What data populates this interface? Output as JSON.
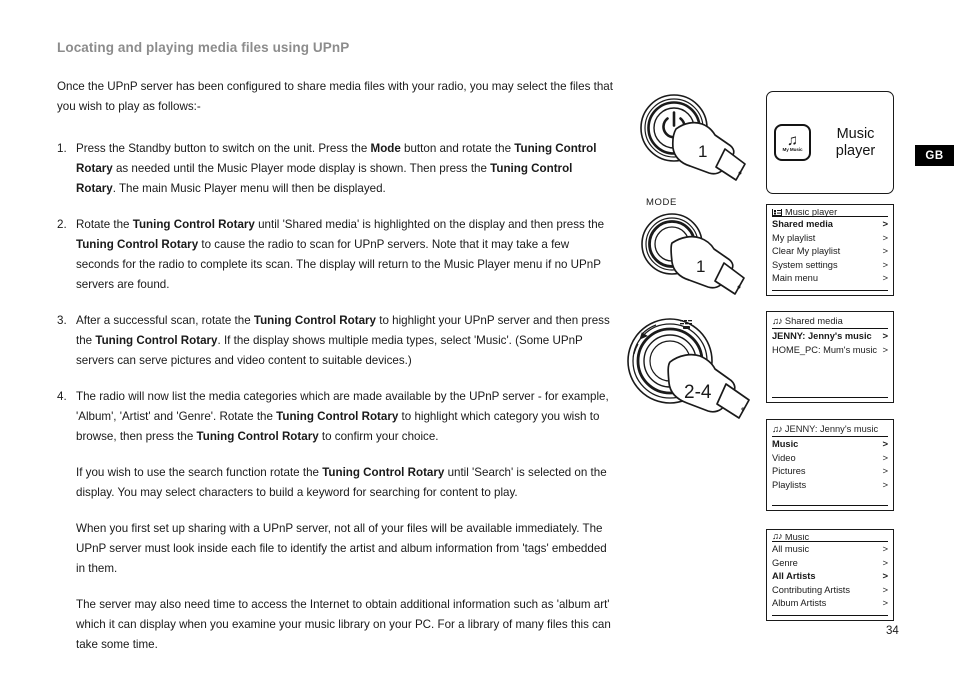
{
  "page": {
    "heading": "Locating and playing media files using UPnP",
    "number": "34",
    "region_badge": "GB"
  },
  "body": {
    "intro": "Once the UPnP server has been configured to share media files with your radio, you may select the files that you wish to play as follows:-",
    "steps": [
      {
        "num": "1.",
        "parts": [
          {
            "t": "Press the Standby button to switch on the unit. Press the ",
            "b": false
          },
          {
            "t": "Mode",
            "b": true
          },
          {
            "t": " button and rotate the ",
            "b": false
          },
          {
            "t": "Tuning Control Rotary",
            "b": true
          },
          {
            "t": " as needed until the Music Player mode display is shown. Then press the ",
            "b": false
          },
          {
            "t": "Tuning Control Rotary",
            "b": true
          },
          {
            "t": ". The main Music Player menu will then be displayed.",
            "b": false
          }
        ]
      },
      {
        "num": "2.",
        "parts": [
          {
            "t": "Rotate the ",
            "b": false
          },
          {
            "t": "Tuning Control Rotary",
            "b": true
          },
          {
            "t": " until 'Shared media' is highlighted on the display and then press the ",
            "b": false
          },
          {
            "t": "Tuning Control Rotary",
            "b": true
          },
          {
            "t": " to cause the radio to scan for UPnP servers. Note that it may take a few seconds for the radio to complete its scan. The display will return to the Music Player menu if no UPnP servers are found.",
            "b": false
          }
        ]
      },
      {
        "num": "3.",
        "parts": [
          {
            "t": "After a successful scan, rotate the ",
            "b": false
          },
          {
            "t": "Tuning Control Rotary",
            "b": true
          },
          {
            "t": " to highlight your UPnP server and then press the ",
            "b": false
          },
          {
            "t": "Tuning Control Rotary",
            "b": true
          },
          {
            "t": ". If the display shows multiple media types, select 'Music'. (Some UPnP servers can serve pictures and video content to suitable devices.)",
            "b": false
          }
        ]
      },
      {
        "num": "4.",
        "parts": [
          {
            "t": "The radio will now list the media categories which are made available by the UPnP server - for example, 'Album', 'Artist' and 'Genre'. Rotate the ",
            "b": false
          },
          {
            "t": "Tuning Control Rotary",
            "b": true
          },
          {
            "t": " to highlight which category you wish to browse, then press the ",
            "b": false
          },
          {
            "t": "Tuning Control Rotary",
            "b": true
          },
          {
            "t": " to confirm your choice.",
            "b": false
          }
        ],
        "sub_parts": [
          {
            "t": "If you wish to use the search function rotate the ",
            "b": false
          },
          {
            "t": "Tuning Control Rotary",
            "b": true
          },
          {
            "t": " until 'Search' is selected on the display. You may select characters to build a keyword for searching for content to play.",
            "b": false
          }
        ]
      }
    ],
    "notes": [
      "When you first set up sharing with a UPnP server, not all of your files will be available immediately. The UPnP server must look inside each file to identify the artist and album information from 'tags' embedded in them.",
      "The server may also need time to access the Internet to obtain additional information such as 'album art' which it can display when you examine your music library on your PC. For a library of many files this can take some time."
    ]
  },
  "illustrations": [
    {
      "name": "standby-button-press",
      "step_label": "1",
      "caption": ""
    },
    {
      "name": "mode-button-press",
      "step_label": "1",
      "caption": "MODE"
    },
    {
      "name": "tuning-control-rotary",
      "step_label": "2-4",
      "caption": ""
    }
  ],
  "displays": {
    "splash": {
      "icon_label": "My Music",
      "icon_glyph": "♫",
      "title_line1": "Music",
      "title_line2": "player"
    },
    "menus": [
      {
        "header": "Music player",
        "header_icon": "list-icon",
        "rows": [
          {
            "label": "Shared media",
            "chev": ">",
            "selected": true
          },
          {
            "label": "My playlist",
            "chev": ">",
            "selected": false
          },
          {
            "label": "Clear My playlist",
            "chev": ">",
            "selected": false
          },
          {
            "label": "System settings",
            "chev": ">",
            "selected": false
          },
          {
            "label": "Main menu",
            "chev": ">",
            "selected": false
          }
        ]
      },
      {
        "header": "Shared media",
        "header_icon": "note-icon",
        "rows": [
          {
            "label": "JENNY: Jenny's music",
            "chev": ">",
            "selected": true
          },
          {
            "label": "HOME_PC: Mum's music",
            "chev": ">",
            "selected": false
          }
        ]
      },
      {
        "header": "JENNY: Jenny's music",
        "header_icon": "note-icon",
        "rows": [
          {
            "label": "Music",
            "chev": ">",
            "selected": true
          },
          {
            "label": "Video",
            "chev": ">",
            "selected": false
          },
          {
            "label": "Pictures",
            "chev": ">",
            "selected": false
          },
          {
            "label": "Playlists",
            "chev": ">",
            "selected": false
          }
        ]
      },
      {
        "header": "Music",
        "header_icon": "note-icon",
        "rows": [
          {
            "label": "All music",
            "chev": ">",
            "selected": false
          },
          {
            "label": "Genre",
            "chev": ">",
            "selected": false
          },
          {
            "label": "All Artists",
            "chev": ">",
            "selected": true
          },
          {
            "label": "Contributing Artists",
            "chev": ">",
            "selected": false
          },
          {
            "label": "Album Artists",
            "chev": ">",
            "selected": false
          }
        ]
      }
    ]
  },
  "colors": {
    "heading": "#8c8c8c",
    "text": "#1a1a1a",
    "badge_bg": "#000000",
    "badge_fg": "#ffffff",
    "panel_border": "#1a1a1a"
  }
}
